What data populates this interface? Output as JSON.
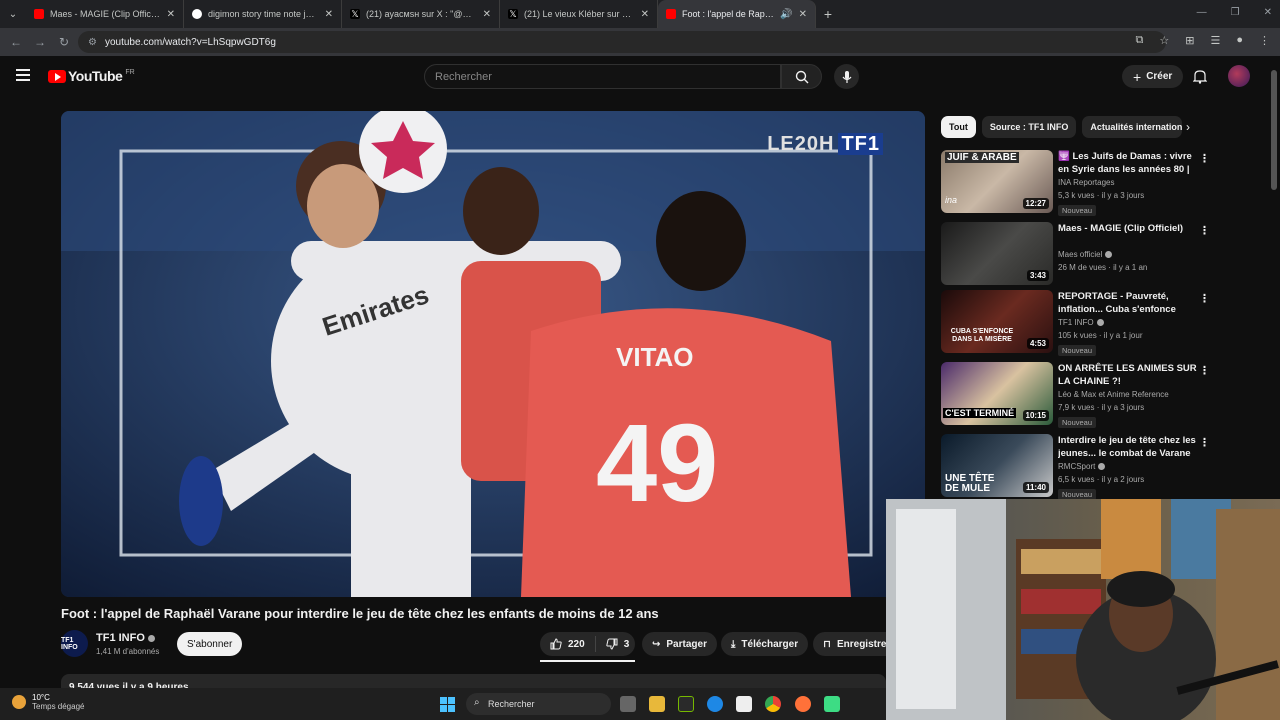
{
  "browser": {
    "tabs": [
      {
        "title": "Maes - MAGIE (Clip Officiel) - Y",
        "favicon_color": "#ff0000"
      },
      {
        "title": "digimon story time note jvc - Re",
        "favicon_color": "#ffffff"
      },
      {
        "title": "(21) ayacмsн sur X : \"@SindyOf",
        "favicon_color": "#000000"
      },
      {
        "title": "(21) Le vieux Kléber sur X : \"Les",
        "favicon_color": "#000000"
      },
      {
        "title": "Foot : l'appel de Raphaël Va",
        "favicon_color": "#ff0000"
      }
    ],
    "url": "youtube.com/watch?v=LhSqpwGDT6g"
  },
  "youtube": {
    "logo_text": "YouTube",
    "region": "FR",
    "search_placeholder": "Rechercher",
    "create_label": "Créer",
    "video": {
      "watermark_left": "LE20H",
      "watermark_right": "TF1",
      "title": "Foot : l'appel de Raphaël Varane pour interdire le jeu de tête chez les enfants de moins de 12 ans",
      "channel": "TF1 INFO",
      "channel_logo_text": "TF1 INFO",
      "subscribers": "1,41 M d'abonnés",
      "subscribe_label": "S'abonner",
      "likes": "220",
      "dislikes": "3",
      "share_label": "Partager",
      "download_label": "Télécharger",
      "save_label": "Enregistrer",
      "description_preview": "9 544 vues  il y a 9 heures"
    },
    "chips": [
      "Tout",
      "Source : TF1 INFO",
      "Actualités internationales"
    ],
    "recommendations": [
      {
        "title": "🕎 Les Juifs de Damas : vivre en Syrie dans les années 80 | ...",
        "channel": "INA Reportages",
        "meta": "5,3 k vues · il y a 3 jours",
        "duration": "12:27",
        "badge": "Nouveau",
        "verified": false,
        "thumb_text": "JUIF & ARABE"
      },
      {
        "title": "Maes - MAGIE (Clip Officiel)",
        "channel": "Maes officiel",
        "meta": "26 M de vues · il y a 1 an",
        "duration": "3:43",
        "badge": "",
        "verified": true,
        "thumb_text": ""
      },
      {
        "title": "REPORTAGE - Pauvreté, inflation... Cuba s'enfonce dan...",
        "channel": "TF1 INFO",
        "meta": "105 k vues · il y a 1 jour",
        "duration": "4:53",
        "badge": "Nouveau",
        "verified": true,
        "thumb_text": "CUBA S'ENFONCE DANS LA MISÈRE"
      },
      {
        "title": "ON ARRÊTE LES ANIMES SUR LA CHAINE ?!",
        "channel": "Léo & Max et Anime Reference",
        "meta": "7,9 k vues · il y a 3 jours",
        "duration": "10:15",
        "badge": "Nouveau",
        "verified": false,
        "thumb_text": "C'EST TERMINÉ"
      },
      {
        "title": "Interdire le jeu de tête chez les jeunes... le combat de Varane ...",
        "channel": "RMCSport",
        "meta": "6,5 k vues · il y a 2 jours",
        "duration": "11:40",
        "badge": "Nouveau",
        "verified": true,
        "thumb_text": "UNE TÊTE DE MULE"
      }
    ]
  },
  "taskbar": {
    "temperature": "10°C",
    "weather": "Temps dégagé",
    "search_placeholder": "Rechercher"
  }
}
